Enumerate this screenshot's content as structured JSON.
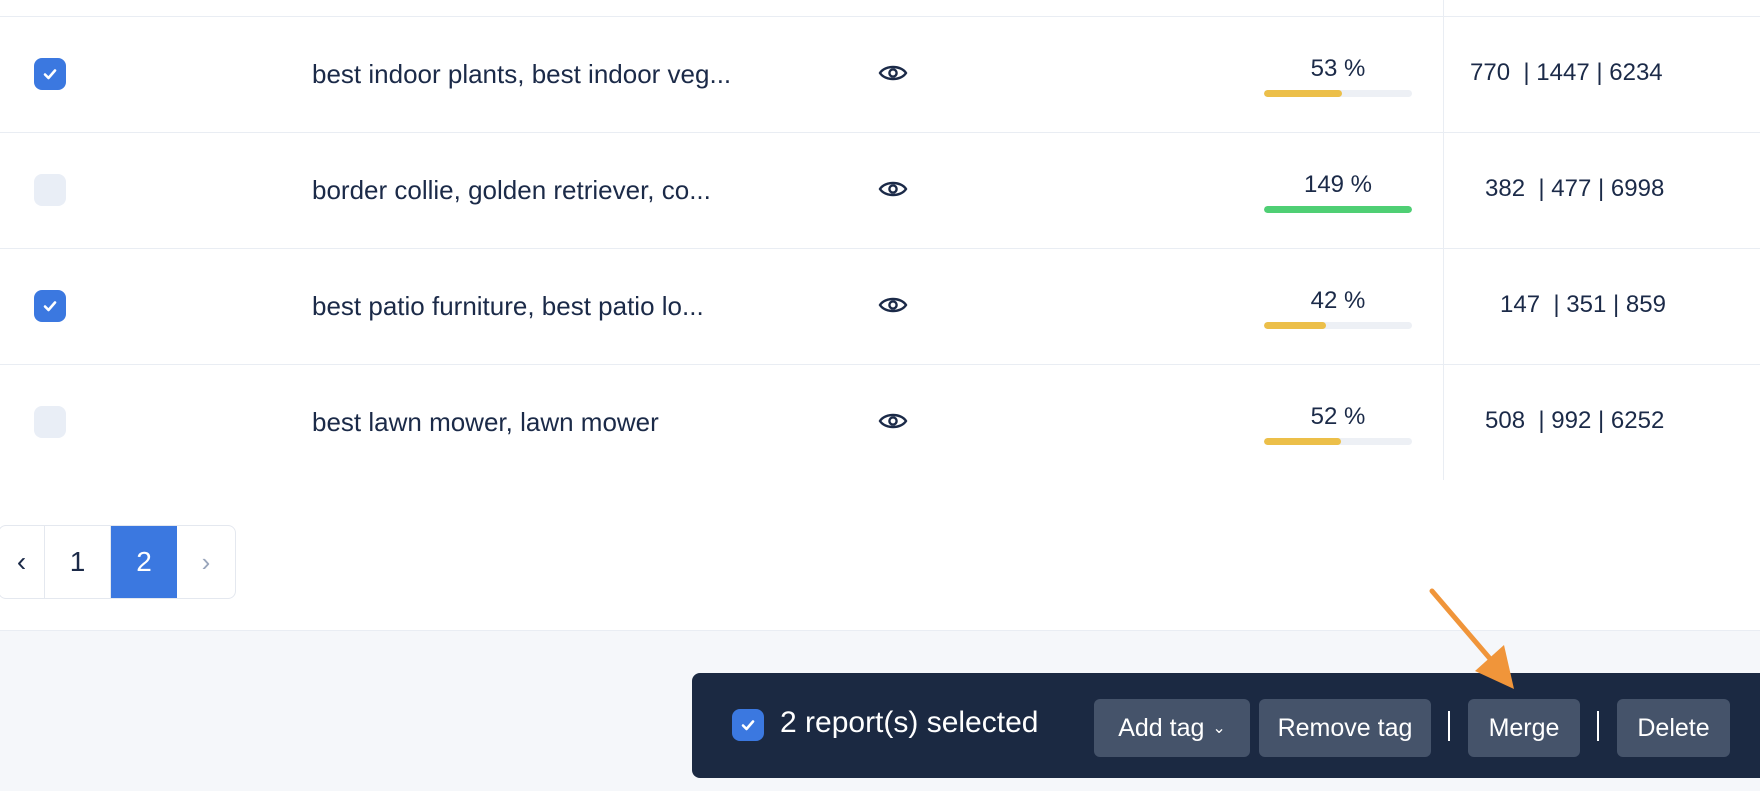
{
  "rows": [
    {
      "checked": true,
      "keywords": "best indoor plants, best indoor veg...",
      "percent_label": "53 %",
      "percent": 53,
      "bar_color": "#ecbf49",
      "numbers": "770  | 1447 | 6234"
    },
    {
      "checked": false,
      "keywords": "border collie, golden retriever, co...",
      "percent_label": "149 %",
      "percent": 100,
      "bar_color": "#4fcf74",
      "numbers": "382  | 477 | 6998"
    },
    {
      "checked": true,
      "keywords": "best patio furniture, best patio lo...",
      "percent_label": "42 %",
      "percent": 42,
      "bar_color": "#ecbf49",
      "numbers": "147  | 351 | 859"
    },
    {
      "checked": false,
      "keywords": "best lawn mower, lawn mower",
      "percent_label": "52 %",
      "percent": 52,
      "bar_color": "#ecbf49",
      "numbers": "508  | 992 | 6252"
    }
  ],
  "pagination": {
    "prev": "‹",
    "pages": [
      "1",
      "2"
    ],
    "current": "2",
    "next": "›"
  },
  "action_bar": {
    "selected_label": "2 report(s) selected",
    "add_tag": "Add tag",
    "add_tag_chevron": "⌄",
    "remove_tag": "Remove tag",
    "merge": "Merge",
    "delete": "Delete"
  },
  "colors": {
    "accent": "#3b78e0",
    "bar_warning": "#ecbf49",
    "bar_success": "#4fcf74",
    "action_bar_bg": "#1b2942",
    "annotation_arrow": "#f0953a"
  },
  "icons": {
    "visibility": "eye-icon",
    "check": "check-icon"
  }
}
